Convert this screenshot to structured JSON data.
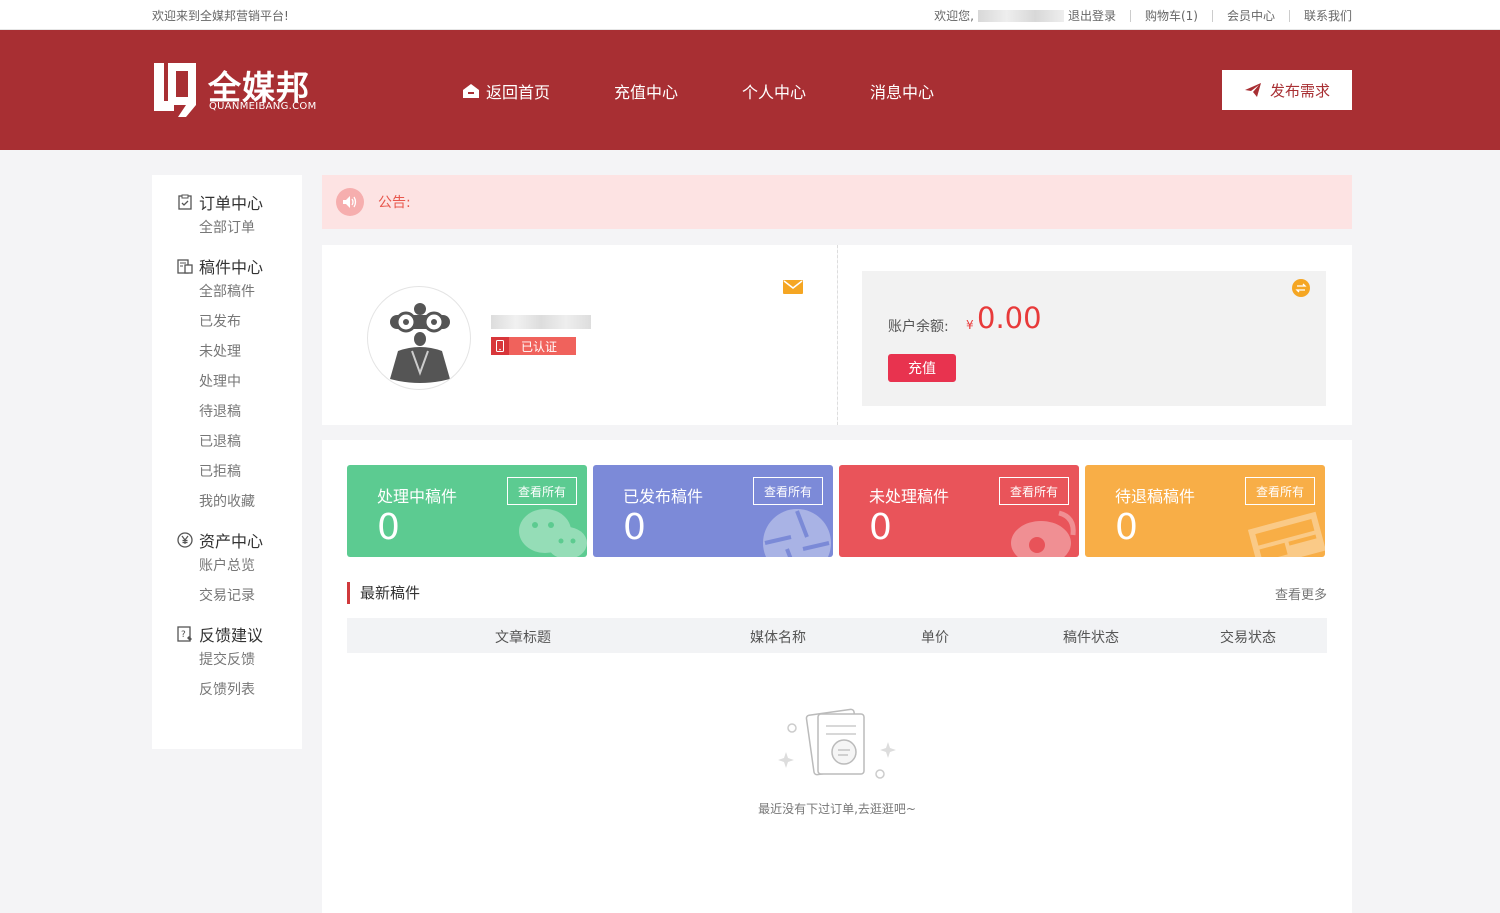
{
  "topbar": {
    "welcome": "欢迎来到全媒邦营销平台!",
    "greeting": "欢迎您,",
    "logout": "退出登录",
    "cart": "购物车(1)",
    "member": "会员中心",
    "contact": "联系我们"
  },
  "header": {
    "logo_name": "全媒邦",
    "logo_domain": "QUANMEIBANG.COM",
    "nav": [
      {
        "label": "返回首页"
      },
      {
        "label": "充值中心"
      },
      {
        "label": "个人中心"
      },
      {
        "label": "消息中心"
      }
    ],
    "publish": "发布需求",
    "bg_color": "#a82f33"
  },
  "sidebar": {
    "groups": [
      {
        "title": "订单中心",
        "icon": "clipboard-icon",
        "items": [
          "全部订单"
        ]
      },
      {
        "title": "稿件中心",
        "icon": "document-icon",
        "items": [
          "全部稿件",
          "已发布",
          "未处理",
          "处理中",
          "待退稿",
          "已退稿",
          "已拒稿",
          "我的收藏"
        ]
      },
      {
        "title": "资产中心",
        "icon": "yen-icon",
        "items": [
          "账户总览",
          "交易记录"
        ]
      },
      {
        "title": "反馈建议",
        "icon": "feedback-icon",
        "items": [
          "提交反馈",
          "反馈列表"
        ]
      }
    ]
  },
  "notice": {
    "label": "公告:"
  },
  "profile": {
    "verified": "已认证"
  },
  "balance": {
    "label": "账户余额:",
    "currency": "¥",
    "amount": "0.00",
    "recharge": "充值"
  },
  "stats": [
    {
      "title": "处理中稿件",
      "value": "0",
      "view": "查看所有",
      "color": "#5ccb91",
      "icon": "wechat-icon"
    },
    {
      "title": "已发布稿件",
      "value": "0",
      "view": "查看所有",
      "color": "#7c8ad8",
      "icon": "camera-aperture-icon"
    },
    {
      "title": "未处理稿件",
      "value": "0",
      "view": "查看所有",
      "color": "#e9545a",
      "icon": "weibo-icon"
    },
    {
      "title": "待退稿稿件",
      "value": "0",
      "view": "查看所有",
      "color": "#f8ae47",
      "icon": "news-icon"
    }
  ],
  "latest": {
    "title": "最新稿件",
    "view_more": "查看更多",
    "columns": [
      "文章标题",
      "媒体名称",
      "单价",
      "稿件状态",
      "交易状态"
    ],
    "empty_text": "最近没有下过订单,去逛逛吧~"
  }
}
